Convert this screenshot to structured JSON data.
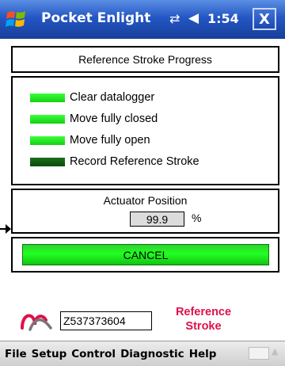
{
  "titlebar": {
    "app_title": "Pocket Enlight",
    "time": "1:54",
    "close_label": "X",
    "icons": {
      "start": "windows-flag-icon",
      "network": "connectivity-icon",
      "volume": "speaker-icon"
    }
  },
  "header": {
    "title": "Reference Stroke Progress"
  },
  "steps": [
    {
      "label": "Clear datalogger",
      "status": "done"
    },
    {
      "label": "Move fully closed",
      "status": "done"
    },
    {
      "label": "Move fully open",
      "status": "done"
    },
    {
      "label": "Record Reference Stroke",
      "status": "active"
    }
  ],
  "position": {
    "label": "Actuator Position",
    "value": "99.9",
    "unit": "%"
  },
  "cancel": {
    "label": "CANCEL"
  },
  "footer": {
    "serial": "Z537373604",
    "mode_line1": "Reference",
    "mode_line2": "Stroke"
  },
  "menu": {
    "items": [
      "File",
      "Setup",
      "Control",
      "Diagnostic",
      "Help"
    ]
  },
  "colors": {
    "titlebar": "#2456c4",
    "step_done": "#22ff22",
    "step_active": "#0a4a0a",
    "cancel_bg": "#22ff22",
    "mode_text": "#e0104a"
  }
}
